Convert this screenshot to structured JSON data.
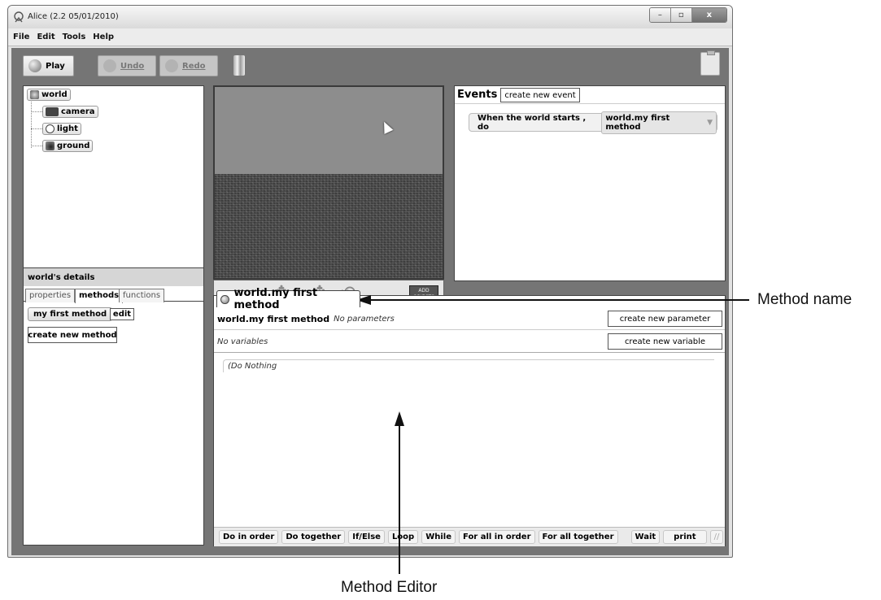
{
  "window": {
    "title": "Alice (2.2  05/01/2010)",
    "buttons": {
      "minimize": "–",
      "maximize": "▫",
      "close": "x"
    }
  },
  "menu": [
    "File",
    "Edit",
    "Tools",
    "Help"
  ],
  "toolbar": {
    "play": "Play",
    "undo": "Undo",
    "redo": "Redo"
  },
  "object_tree": {
    "root": "world",
    "children": [
      "camera",
      "light",
      "ground"
    ]
  },
  "scene": {
    "add_objects": "ADD OBJECTS"
  },
  "events": {
    "title": "Events",
    "create_button": "create new event",
    "row_prefix": "When the world starts , do",
    "row_method": "world.my first method"
  },
  "details": {
    "title": "world's details",
    "tabs": [
      "properties",
      "methods",
      "functions"
    ],
    "active_tab": "methods",
    "method_name": "my first method",
    "edit_label": "edit",
    "create_method": "create new method"
  },
  "editor": {
    "tab_title": "world.my first method",
    "header_name": "world.my first method",
    "no_params": "No parameters",
    "create_param": "create new parameter",
    "no_vars": "No variables",
    "create_var": "create new variable",
    "body_placeholder": "(Do Nothing",
    "controls": [
      "Do in order",
      "Do together",
      "If/Else",
      "Loop",
      "While",
      "For all in order",
      "For all together",
      "Wait",
      "print",
      "//"
    ]
  },
  "callouts": {
    "method_name": "Method name",
    "method_editor": "Method Editor"
  },
  "colors": {
    "workspace": "#757575",
    "panel": "#ffffff",
    "accent_dark": "#444444"
  }
}
